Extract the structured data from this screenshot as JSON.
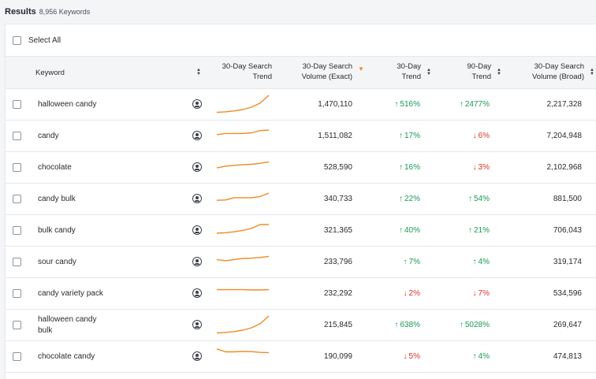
{
  "header": {
    "title": "Results",
    "count": "8,956 Keywords"
  },
  "select_all": {
    "label": "Select All"
  },
  "columns": {
    "keyword": "Keyword",
    "trend_30_line1": "30-Day Search",
    "trend_30_line2": "Trend",
    "vol_exact_line1": "30-Day Search",
    "vol_exact_line2": "Volume (Exact)",
    "trend30_line1": "30-Day",
    "trend30_line2": "Trend",
    "trend90_line1": "90-Day",
    "trend90_line2": "Trend",
    "vol_broad_line1": "30-Day Search",
    "vol_broad_line2": "Volume (Broad)"
  },
  "colors": {
    "up": "#1a9a52",
    "down": "#d8342a",
    "sparkline": "#f08a24",
    "sort_active": "#f08a24"
  },
  "rows": [
    {
      "keyword": "halloween candy",
      "volume_exact": "1,470,110",
      "trend30": "516%",
      "trend30_dir": "up",
      "trend90": "2477%",
      "trend90_dir": "up",
      "volume_broad": "2,217,328",
      "spark": [
        0.02,
        0.05,
        0.1,
        0.18,
        0.32,
        0.55,
        1.0
      ]
    },
    {
      "keyword": "candy",
      "volume_exact": "1,511,082",
      "trend30": "17%",
      "trend30_dir": "up",
      "trend90": "6%",
      "trend90_dir": "down",
      "volume_broad": "7,204,948",
      "spark": [
        0.55,
        0.62,
        0.62,
        0.62,
        0.66,
        0.78,
        0.82
      ]
    },
    {
      "keyword": "chocolate",
      "volume_exact": "528,590",
      "trend30": "16%",
      "trend30_dir": "up",
      "trend90": "3%",
      "trend90_dir": "down",
      "volume_broad": "2,102,968",
      "spark": [
        0.45,
        0.55,
        0.6,
        0.63,
        0.66,
        0.72,
        0.8
      ]
    },
    {
      "keyword": "candy bulk",
      "volume_exact": "340,733",
      "trend30": "22%",
      "trend30_dir": "up",
      "trend90": "54%",
      "trend90_dir": "up",
      "volume_broad": "881,500",
      "spark": [
        0.4,
        0.42,
        0.55,
        0.55,
        0.55,
        0.62,
        0.82
      ]
    },
    {
      "keyword": "bulk candy",
      "volume_exact": "321,365",
      "trend30": "40%",
      "trend30_dir": "up",
      "trend90": "21%",
      "trend90_dir": "up",
      "volume_broad": "706,043",
      "spark": [
        0.32,
        0.35,
        0.4,
        0.48,
        0.6,
        0.82,
        0.82
      ]
    },
    {
      "keyword": "sour candy",
      "volume_exact": "233,796",
      "trend30": "7%",
      "trend30_dir": "up",
      "trend90": "4%",
      "trend90_dir": "up",
      "volume_broad": "319,174",
      "spark": [
        0.62,
        0.55,
        0.62,
        0.68,
        0.7,
        0.74,
        0.8
      ]
    },
    {
      "keyword": "candy variety pack",
      "volume_exact": "232,292",
      "trend30": "2%",
      "trend30_dir": "down",
      "trend90": "7%",
      "trend90_dir": "down",
      "volume_broad": "534,596",
      "spark": [
        0.7,
        0.7,
        0.7,
        0.7,
        0.68,
        0.68,
        0.7
      ]
    },
    {
      "keyword": "halloween candy bulk",
      "volume_exact": "215,845",
      "trend30": "638%",
      "trend30_dir": "up",
      "trend90": "5028%",
      "trend90_dir": "up",
      "volume_broad": "269,647",
      "spark": [
        0.02,
        0.05,
        0.1,
        0.18,
        0.32,
        0.55,
        1.0
      ]
    },
    {
      "keyword": "chocolate candy",
      "volume_exact": "190,099",
      "trend30": "5%",
      "trend30_dir": "down",
      "trend90": "4%",
      "trend90_dir": "up",
      "volume_broad": "474,813",
      "spark": [
        0.92,
        0.75,
        0.75,
        0.77,
        0.76,
        0.72,
        0.7
      ]
    }
  ]
}
